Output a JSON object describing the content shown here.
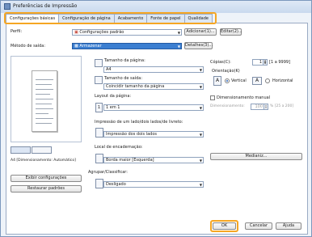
{
  "window": {
    "title": "Preferências de Impressão"
  },
  "tabs": [
    {
      "label": "Configurações básicas",
      "active": true
    },
    {
      "label": "Configuração de página",
      "active": false
    },
    {
      "label": "Acabamento",
      "active": false
    },
    {
      "label": "Fonte de papel",
      "active": false
    },
    {
      "label": "Qualidade",
      "active": false
    }
  ],
  "profile": {
    "label": "Perfil:",
    "value": "Configurações padrão",
    "add_button": "Adicionar(1)...",
    "edit_button": "Editar(2)..."
  },
  "output_method": {
    "label": "Método de saída:",
    "value": "Armazenar",
    "details_button": "Detalhes(3)..."
  },
  "preview": {
    "caption": "A4 [Dimensionamento: Automático]",
    "show_settings_button": "Exibir configurações",
    "restore_defaults_button": "Restaurar padrões"
  },
  "page_size": {
    "label": "Tamanho da página:",
    "value": "A4"
  },
  "output_size": {
    "label": "Tamanho de saída:",
    "value": "Coincidir tamanho da página"
  },
  "copies": {
    "label": "Cópias(C):",
    "value": "1",
    "range": "[1 a 9999]"
  },
  "orientation": {
    "label": "Orientação(K)",
    "portrait": "Vertical",
    "landscape": "Horizontal",
    "selected": "Vertical"
  },
  "page_layout": {
    "label": "Layout da página:",
    "value": "1 em 1"
  },
  "manual_scaling": {
    "label": "Dimensionamento manual",
    "scaling_label": "Dimensionamento:",
    "value": "100",
    "range": "% [25 a 200]"
  },
  "duplex": {
    "label": "Impressão de um lado/dois lados/de livreto:",
    "value": "Impressão dos dois lados"
  },
  "binding": {
    "label": "Local de encadernação:",
    "value": "Borda maior [Esquerda]",
    "margin_button": "Medianiz..."
  },
  "collate": {
    "label": "Agrupar/Classificar:",
    "value": "Desligado"
  },
  "footer": {
    "ok": "OK",
    "cancel": "Cancelar",
    "help": "Ajuda"
  }
}
